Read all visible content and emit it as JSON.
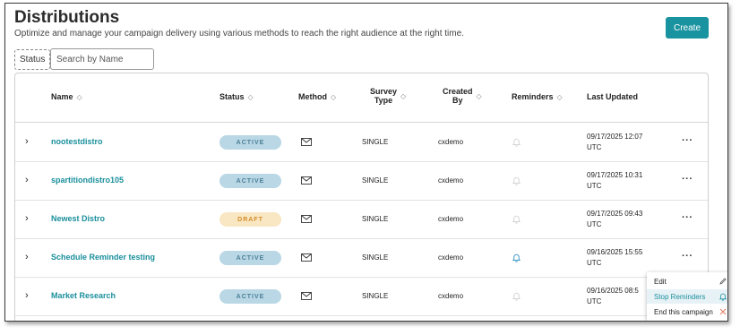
{
  "header": {
    "title": "Distributions",
    "subtitle": "Optimize and manage your campaign delivery using various methods to reach the right audience at the right time.",
    "create_label": "Create"
  },
  "filters": {
    "status_chip": "Status",
    "search_placeholder": "Search by Name"
  },
  "columns": {
    "name": "Name",
    "status": "Status",
    "method": "Method",
    "survey_type_line1": "Survey",
    "survey_type_line2": "Type",
    "created_by_line1": "Created",
    "created_by_line2": "By",
    "reminders": "Reminders",
    "last_updated": "Last Updated"
  },
  "rows": [
    {
      "name": "nootestdistro",
      "status": "ACTIVE",
      "status_kind": "active",
      "method_icon": "mail-icon",
      "survey_type": "SINGLE",
      "created_by": "cxdemo",
      "reminder_active": false,
      "updated_line1": "09/17/2025 12:07",
      "updated_line2": "UTC"
    },
    {
      "name": "spartitiondistro105",
      "status": "ACTIVE",
      "status_kind": "active",
      "method_icon": "mail-icon",
      "survey_type": "SINGLE",
      "created_by": "cxdemo",
      "reminder_active": false,
      "updated_line1": "09/17/2025 10:31",
      "updated_line2": "UTC"
    },
    {
      "name": "Newest Distro",
      "status": "DRAFT",
      "status_kind": "draft",
      "method_icon": "mail-icon",
      "survey_type": "SINGLE",
      "created_by": "cxdemo",
      "reminder_active": false,
      "updated_line1": "09/17/2025 09:43",
      "updated_line2": "UTC"
    },
    {
      "name": "Schedule Reminder testing",
      "status": "ACTIVE",
      "status_kind": "active",
      "method_icon": "mail-icon",
      "survey_type": "SINGLE",
      "created_by": "cxdemo",
      "reminder_active": true,
      "updated_line1": "09/16/2025 15:55",
      "updated_line2": "UTC"
    },
    {
      "name": "Market Research",
      "status": "ACTIVE",
      "status_kind": "active",
      "method_icon": "mail-icon",
      "survey_type": "SINGLE",
      "created_by": "cxdemo",
      "reminder_active": false,
      "updated_line1": "09/16/2025 08:5",
      "updated_line2": "UTC"
    }
  ],
  "row_menu": {
    "edit": "Edit",
    "stop_reminders": "Stop Reminders",
    "end_campaign": "End this campaign"
  },
  "colors": {
    "accent": "#1a93a0",
    "link": "#1a8f9c",
    "active_badge_bg": "#b9d7e5",
    "draft_badge_bg": "#f9e7c3",
    "close_icon": "#e07a5f"
  }
}
